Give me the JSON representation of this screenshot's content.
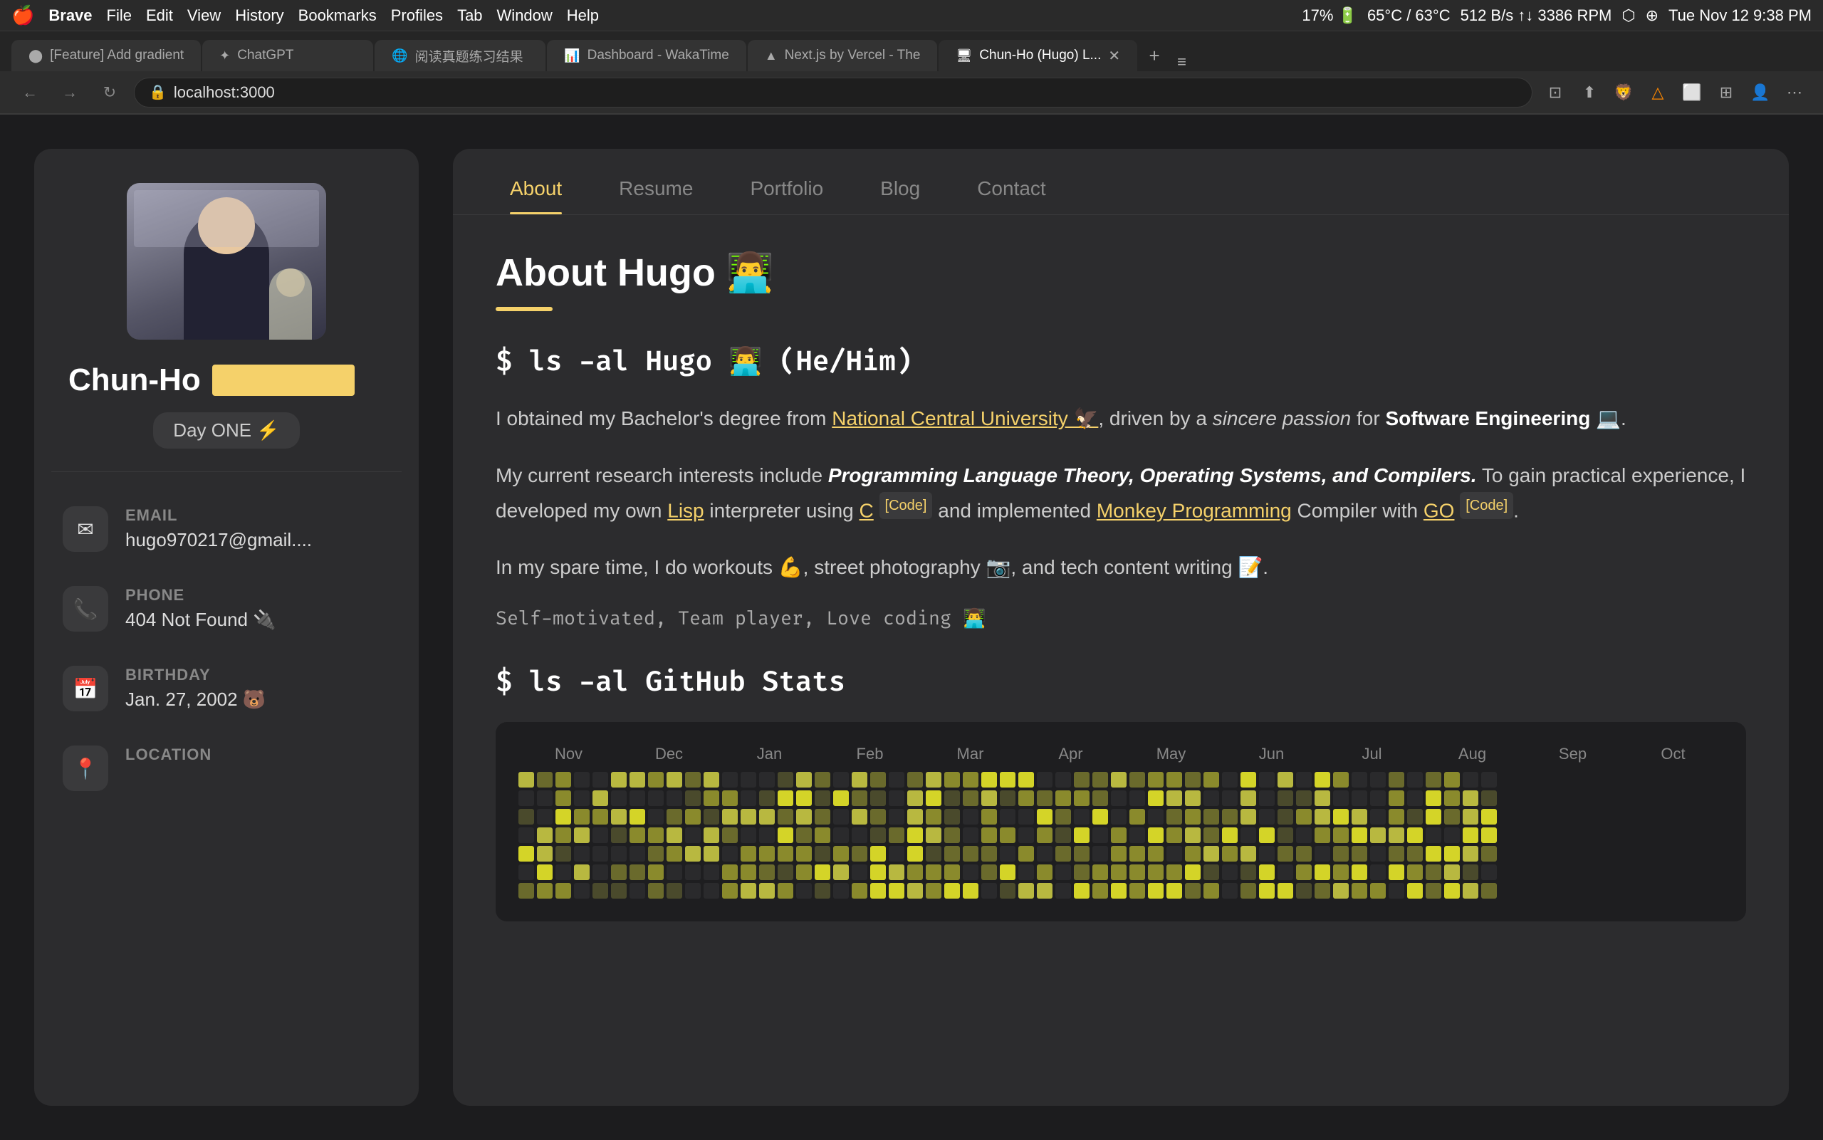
{
  "menubar": {
    "apple": "🍎",
    "app_name": "Brave",
    "menus": [
      "File",
      "Edit",
      "View",
      "History",
      "Bookmarks",
      "Profiles",
      "Tab",
      "Window",
      "Help"
    ],
    "right_info": "17% 🔋  65°C / 63°C  512 B/s  3386 RPM  512 B/s",
    "time": "Tue Nov 12  9:38 PM"
  },
  "tabs": [
    {
      "id": "tab1",
      "favicon": "⬤",
      "title": "[Feature] Add gradient",
      "active": false
    },
    {
      "id": "tab2",
      "favicon": "✦",
      "title": "ChatGPT",
      "active": false
    },
    {
      "id": "tab3",
      "favicon": "🌐",
      "title": "阅读真题练习结果",
      "active": false
    },
    {
      "id": "tab4",
      "favicon": "📊",
      "title": "Dashboard - WakaTime",
      "active": false
    },
    {
      "id": "tab5",
      "favicon": "▲",
      "title": "Next.js by Vercel - The",
      "active": false
    },
    {
      "id": "tab6",
      "favicon": "🖥",
      "title": "Chun-Ho (Hugo) L...",
      "active": true
    }
  ],
  "url_bar": {
    "favicon": "🔒",
    "url": "localhost:3000"
  },
  "sidebar": {
    "name": "Chun-Ho",
    "badge": "Day ONE ⚡",
    "contacts": [
      {
        "id": "email",
        "icon": "✉",
        "label": "EMAIL",
        "value": "hugo970217@gmail...."
      },
      {
        "id": "phone",
        "icon": "📞",
        "label": "PHONE",
        "value": "404 Not Found 🔌"
      },
      {
        "id": "birthday",
        "icon": "📅",
        "label": "BIRTHDAY",
        "value": "Jan. 27, 2002 🐻"
      },
      {
        "id": "location",
        "icon": "📍",
        "label": "LOCATION",
        "value": ""
      }
    ]
  },
  "nav_tabs": [
    {
      "id": "about",
      "label": "About",
      "active": true
    },
    {
      "id": "resume",
      "label": "Resume",
      "active": false
    },
    {
      "id": "portfolio",
      "label": "Portfolio",
      "active": false
    },
    {
      "id": "blog",
      "label": "Blog",
      "active": false
    },
    {
      "id": "contact",
      "label": "Contact",
      "active": false
    }
  ],
  "about": {
    "title": "About Hugo 👨‍💻",
    "cmd1": "$ ls -al Hugo 👨‍💻 (He/Him)",
    "bio_parts": [
      "I obtained my Bachelor's degree from",
      "National Central University 🦅",
      ", driven by a",
      "sincere passion",
      "for",
      "Software Engineering 💻",
      "."
    ],
    "bio2": "My current research interests include Programming Language Theory, Operating Systems, and Compilers. To gain practical experience, I developed my own Lisp interpreter using C [Code] and implemented Monkey Programming Compiler with GO [Code].",
    "bio3": "In my spare time, I do workouts 💪, street photography 📷, and tech content writing 📝.",
    "tags": "Self-motivated, Team player, Love coding 👨‍💻",
    "cmd2": "$ ls -al GitHub Stats",
    "months": [
      "Nov",
      "Dec",
      "Jan",
      "Feb",
      "Mar",
      "Apr",
      "May",
      "Jun",
      "Jul",
      "Aug",
      "Sep",
      "Oct"
    ]
  }
}
